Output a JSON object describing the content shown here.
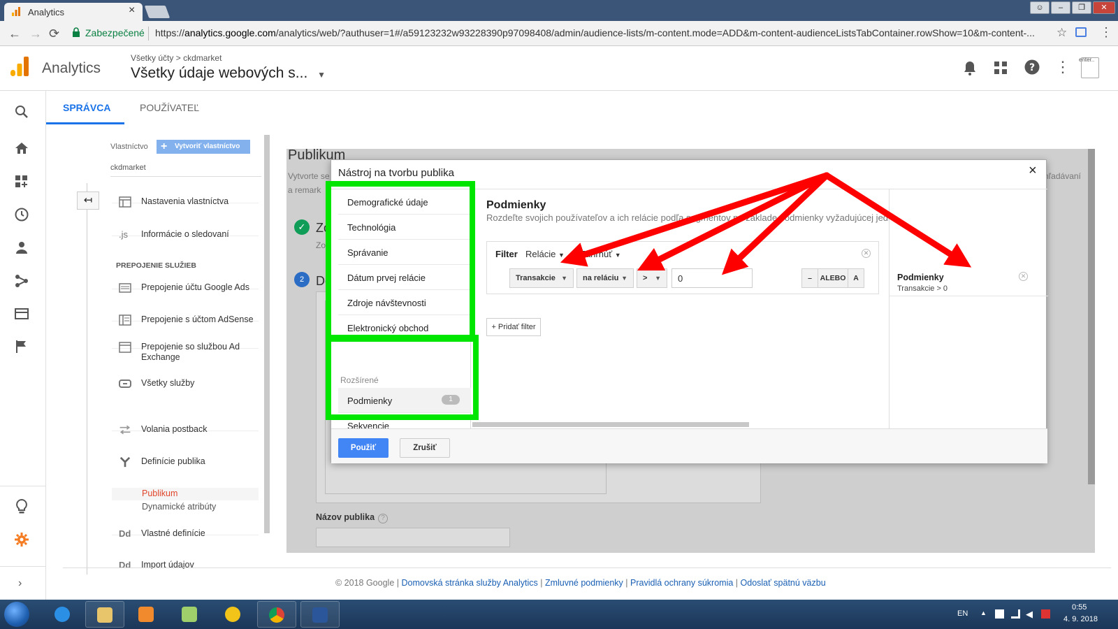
{
  "browser": {
    "tab_title": "Analytics",
    "tab_close": "×",
    "secure_label": "Zabezpečené",
    "url_prefix": "https://",
    "url_host": "analytics.google.com",
    "url_path": "/analytics/web/?authuser=1#/a59123232w93228390p97098408/admin/audience-lists/m-content.mode=ADD&m-content-audienceListsTabContainer.rowShow=10&m-content-...",
    "profile_label": "enter.."
  },
  "header": {
    "app_name": "Analytics",
    "breadcrumb_all": "Všetky účty",
    "breadcrumb_sep": ">",
    "breadcrumb_account": "ckdmarket",
    "view_name": "Všetky údaje webových s..."
  },
  "admin_tabs": {
    "admin": "SPRÁVCA",
    "user": "POUŽÍVATEĽ"
  },
  "admin_column": {
    "property_label": "Vlastníctvo",
    "create_property": "Vytvoriť vlastníctvo",
    "property_name": "ckdmarket",
    "back_arrow": "↤",
    "items": [
      {
        "label": "Nastavenia vlastníctva",
        "icon": "settings-window-icon"
      },
      {
        "label": "Informácie o sledovaní",
        "icon": "js-icon",
        "icon_text": ".js"
      }
    ],
    "section_title": "PREPOJENIE SLUŽIEB",
    "links": [
      {
        "label": "Prepojenie účtu Google Ads"
      },
      {
        "label": "Prepojenie s účtom AdSense"
      },
      {
        "label": "Prepojenie so službou Ad Exchange"
      },
      {
        "label": "Všetky služby"
      }
    ],
    "more": [
      {
        "label": "Volania postback"
      },
      {
        "label": "Definície publika"
      }
    ],
    "sub_active": "Publikum",
    "sub_other": "Dynamické atribúty",
    "custom_defs": "Vlastné definície",
    "custom_icon_text": "Dd",
    "import_data": "Import údajov"
  },
  "main": {
    "title": "Publikum",
    "desc_line1": "Vytvorte se",
    "desc_line2": "a remark",
    "desc_right": "vhľadávaní",
    "step1_num": "✓",
    "step1_title": "Zo",
    "step1_sub": "Zo",
    "step2_num": "2",
    "step2_title": "De",
    "name_label": "Názov publika",
    "name_help": "?"
  },
  "modal": {
    "title": "Nástroj na tvorbu publika",
    "close": "×",
    "nav_items": [
      "Demografické údaje",
      "Technológia",
      "Správanie",
      "Dátum prvej relácie",
      "Zdroje návštevnosti",
      "Elektronický obchod"
    ],
    "advanced_label": "Rozšírené",
    "adv_items": [
      {
        "label": "Podmienky",
        "badge": "1"
      },
      {
        "label": "Sekvencie"
      }
    ],
    "cond_title": "Podmienky",
    "cond_desc": "Rozdeľte svojich používateľov a ich relácie podľa segmentov na základe podmienky vyžadujúcej jedin",
    "filter_label": "Filter",
    "filter_scope": "Relácie",
    "filter_mode": "Zahrnúť",
    "metric": "Transakcie",
    "metric_scope": "na reláciu",
    "operator": ">",
    "value": "0",
    "minus": "–",
    "or_btn": "ALEBO",
    "and_btn": "A",
    "add_filter": "+ Pridať filter",
    "summary_title": "Podmienky",
    "summary_detail": "Transakcie > 0",
    "apply": "Použiť",
    "cancel": "Zrušiť"
  },
  "footer": {
    "copyright": "© 2018 Google",
    "sep": "|",
    "link1": "Domovská stránka služby Analytics",
    "link2": "Zmluvné podmienky",
    "link3": "Pravidlá ochrany súkromia",
    "link4": "Odoslať spätnú väzbu"
  },
  "taskbar": {
    "lang": "EN",
    "time": "0:55",
    "date": "4. 9. 2018"
  },
  "colors": {
    "ga_blue": "#1a73e8",
    "highlight_green": "#00e600",
    "arrow_red": "#ff0000",
    "apply_blue": "#4285f4"
  }
}
